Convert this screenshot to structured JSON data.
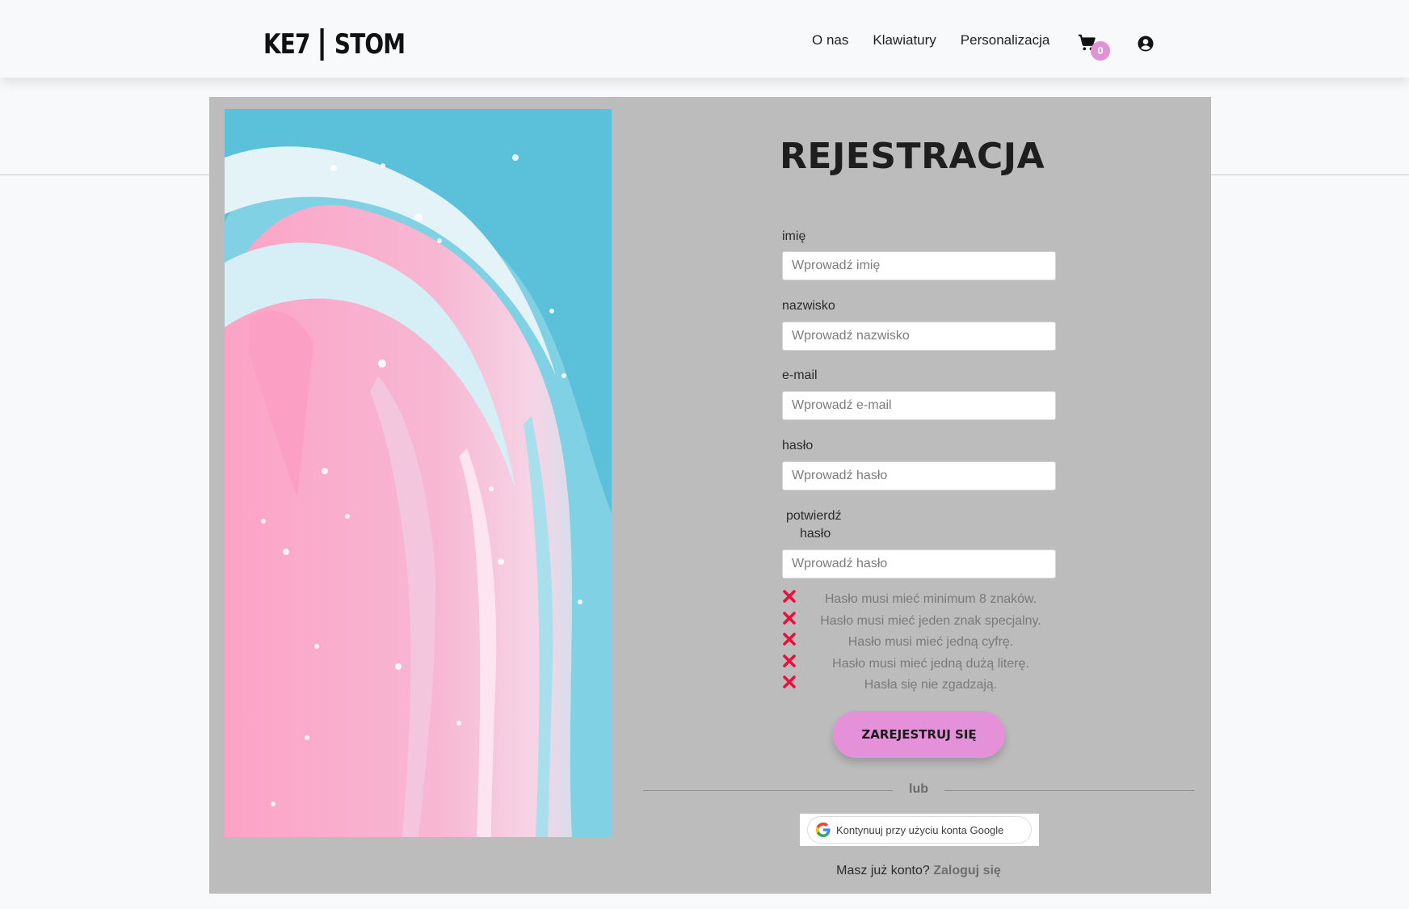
{
  "header": {
    "logo_left": "KE7",
    "logo_right": "STOM",
    "nav": [
      "O nas",
      "Klawiatury",
      "Personalizacja"
    ],
    "cart_count": "0",
    "cart_icon": "cart-icon",
    "user_icon": "user-circle-icon"
  },
  "form": {
    "title": "REJESTRACJA",
    "fields": [
      {
        "label": "imię",
        "placeholder": "Wprowadź imię",
        "value": ""
      },
      {
        "label": "nazwisko",
        "placeholder": "Wprowadź nazwisko",
        "value": ""
      },
      {
        "label": "e-mail",
        "placeholder": "Wprowadź e-mail",
        "value": ""
      },
      {
        "label": "hasło",
        "placeholder": "Wprowadź hasło",
        "value": ""
      },
      {
        "label_line1": "potwierdź",
        "label_line2": "hasło",
        "placeholder": "Wprowadź hasło",
        "value": ""
      }
    ],
    "rules": [
      "Hasło musi mieć minimum 8 znaków.",
      "Hasło musi mieć jeden znak specjalny.",
      "Hasło musi mieć jedną cyfrę.",
      "Hasło musi mieć jedną dużą literę.",
      "Hasła się nie zgadzają."
    ],
    "submit_label": "ZAREJESTRUJ SIĘ",
    "or_label": "lub",
    "google_label": "Kontynuuj przy użyciu konta Google",
    "login_prompt": "Masz już konto?",
    "login_link": "Zaloguj się"
  },
  "colors": {
    "accent": "#e491d9",
    "error": "#e8103c",
    "card": "#bcbcbc",
    "background": "#f8f9fa"
  }
}
